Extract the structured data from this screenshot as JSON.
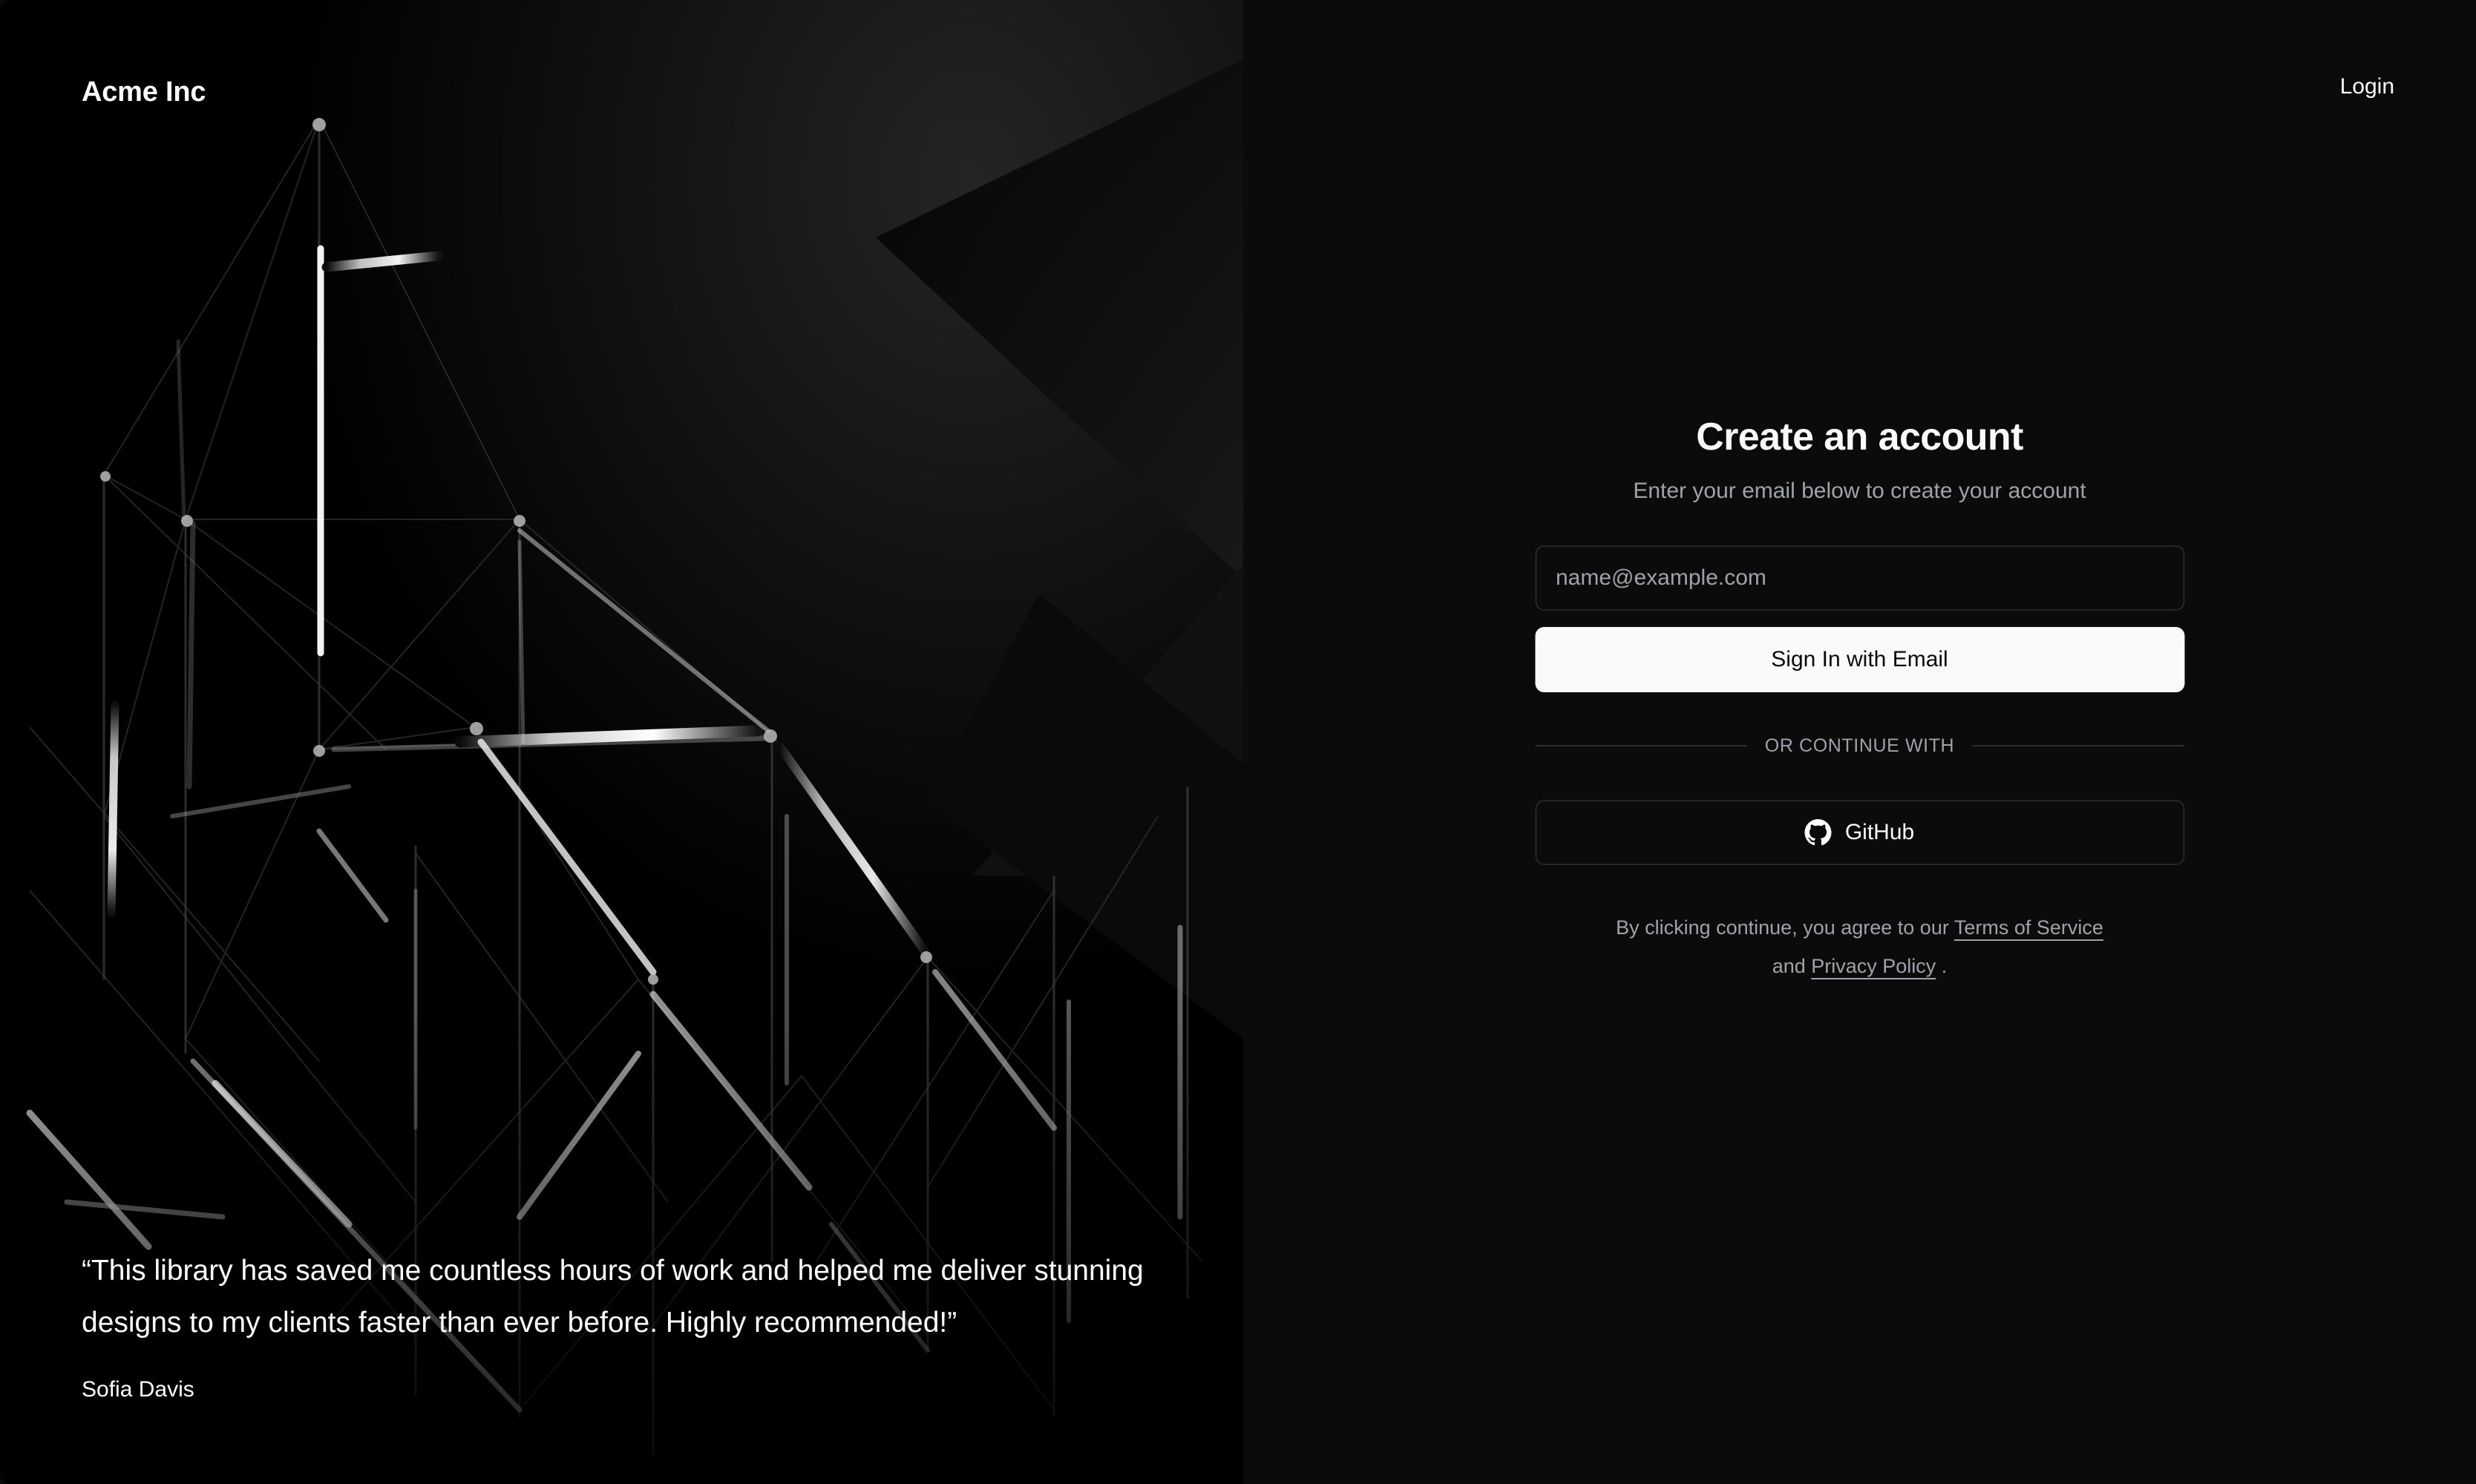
{
  "left": {
    "brand": "Acme Inc",
    "quote": "“This library has saved me countless hours of work and helped me deliver stunning designs to my clients faster than ever before. Highly recommended!”",
    "author": "Sofia Davis",
    "image_alt": "dark-geometric-truss-structure-photo"
  },
  "right": {
    "login_link": "Login",
    "title": "Create an account",
    "subtitle": "Enter your email below to create your account",
    "email": {
      "placeholder": "name@example.com",
      "value": ""
    },
    "submit_label": "Sign In with Email",
    "divider_label": "OR CONTINUE WITH",
    "oauth": {
      "icon": "github-icon",
      "label": "GitHub"
    },
    "legal": {
      "prefix": "By clicking continue, you agree to our ",
      "terms_label": "Terms of Service",
      "conjunction": " and ",
      "privacy_label": "Privacy Policy",
      "suffix": " ."
    }
  },
  "colors": {
    "page_bg": "#0b0b0c",
    "hero_bg": "#000000",
    "text_primary": "#fafafa",
    "text_muted": "#a1a1aa",
    "border": "#26262a",
    "accent_button_bg": "#fafafa",
    "accent_button_text": "#0a0a0a",
    "divider": "#2d2d32"
  }
}
